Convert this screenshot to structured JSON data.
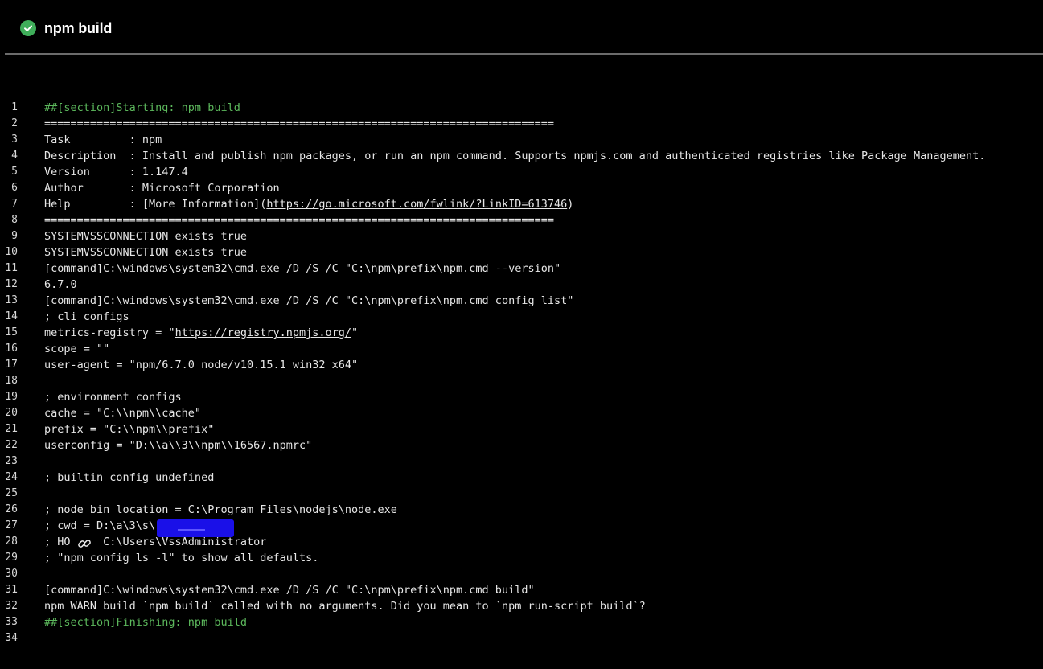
{
  "header": {
    "title": "npm build",
    "status": "succeeded",
    "status_color": "#3fae5a"
  },
  "log": {
    "lines": [
      {
        "n": "1",
        "text": "##[section]Starting: npm build"
      },
      {
        "n": "2",
        "text": "=============================================================================="
      },
      {
        "n": "3",
        "text": "Task         : npm"
      },
      {
        "n": "4",
        "text": "Description  : Install and publish npm packages, or run an npm command. Supports npmjs.com and authenticated registries like Package Management."
      },
      {
        "n": "5",
        "text": "Version      : 1.147.4"
      },
      {
        "n": "6",
        "text": "Author       : Microsoft Corporation"
      },
      {
        "n": "7",
        "pre": "Help         : [More Information](",
        "url": "https://go.microsoft.com/fwlink/?LinkID=613746",
        "post": ")"
      },
      {
        "n": "8",
        "text": "=============================================================================="
      },
      {
        "n": "9",
        "text": "SYSTEMVSSCONNECTION exists true"
      },
      {
        "n": "10",
        "text": "SYSTEMVSSCONNECTION exists true"
      },
      {
        "n": "11",
        "text": "[command]C:\\windows\\system32\\cmd.exe /D /S /C \"C:\\npm\\prefix\\npm.cmd --version\""
      },
      {
        "n": "12",
        "text": "6.7.0"
      },
      {
        "n": "13",
        "text": "[command]C:\\windows\\system32\\cmd.exe /D /S /C \"C:\\npm\\prefix\\npm.cmd config list\""
      },
      {
        "n": "14",
        "text": "; cli configs"
      },
      {
        "n": "15",
        "pre": "metrics-registry = \"",
        "url": "https://registry.npmjs.org/",
        "post": "\""
      },
      {
        "n": "16",
        "text": "scope = \"\""
      },
      {
        "n": "17",
        "text": "user-agent = \"npm/6.7.0 node/v10.15.1 win32 x64\""
      },
      {
        "n": "18",
        "text": ""
      },
      {
        "n": "19",
        "text": "; environment configs"
      },
      {
        "n": "20",
        "text": "cache = \"C:\\\\npm\\\\cache\""
      },
      {
        "n": "21",
        "text": "prefix = \"C:\\\\npm\\\\prefix\""
      },
      {
        "n": "22",
        "text": "userconfig = \"D:\\\\a\\\\3\\\\npm\\\\16567.npmrc\""
      },
      {
        "n": "23",
        "text": ""
      },
      {
        "n": "24",
        "text": "; builtin config undefined"
      },
      {
        "n": "25",
        "text": ""
      },
      {
        "n": "26",
        "text": "; node bin location = C:\\Program Files\\nodejs\\node.exe"
      },
      {
        "n": "27",
        "text": "; cwd = D:\\a\\3\\s\\"
      },
      {
        "n": "28",
        "text": "; HO     C:\\Users\\VssAdministrator"
      },
      {
        "n": "29",
        "text": "; \"npm config ls -l\" to show all defaults."
      },
      {
        "n": "30",
        "text": ""
      },
      {
        "n": "31",
        "text": "[command]C:\\windows\\system32\\cmd.exe /D /S /C \"C:\\npm\\prefix\\npm.cmd build\""
      },
      {
        "n": "32",
        "text": "npm WARN build `npm build` called with no arguments. Did you mean to `npm run-script build`?"
      },
      {
        "n": "33",
        "text": "##[section]Finishing: npm build"
      },
      {
        "n": "34",
        "text": ""
      }
    ]
  },
  "colors": {
    "background": "#000000",
    "text": "#e6e6e6",
    "section": "#5cb85c",
    "divider": "#6b6b6b",
    "redaction": "#1a10e8"
  },
  "icons": {
    "status": "check-circle-icon",
    "link": "link-icon"
  }
}
